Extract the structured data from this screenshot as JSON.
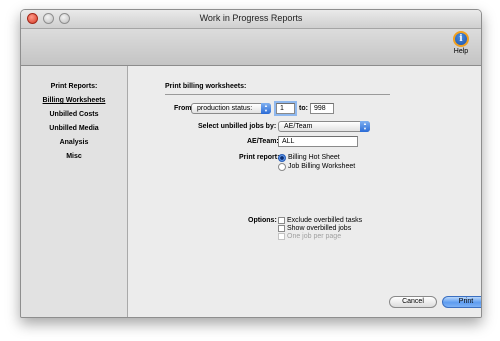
{
  "window": {
    "title": "Work in Progress Reports"
  },
  "toolbar": {
    "help_label": "Help"
  },
  "sidebar": {
    "heading": "Print Reports:",
    "items": [
      {
        "label": "Billing Worksheets",
        "active": true
      },
      {
        "label": "Unbilled Costs"
      },
      {
        "label": "Unbilled Media"
      },
      {
        "label": "Analysis"
      },
      {
        "label": "Misc"
      }
    ]
  },
  "main": {
    "section_title": "Print billing worksheets:",
    "from_label": "From",
    "from_popup": "production status:",
    "from_value": "1",
    "to_label": "to:",
    "to_value": "998",
    "select_label": "Select unbilled jobs by:",
    "select_popup": "AE/Team",
    "ae_label": "AE/Team:",
    "ae_value": "ALL",
    "print_report_label": "Print report:",
    "radio_options": [
      "Billing Hot Sheet",
      "Job Billing Worksheet"
    ],
    "options_label": "Options:",
    "checkboxes": [
      "Exclude overbilled tasks",
      "Show overbilled jobs",
      "One job per page"
    ],
    "cancel_label": "Cancel",
    "print_label": "Print"
  },
  "colors": {
    "accent": "#5e9cf0",
    "sidebar_bg": "#e2e2e2",
    "panel_bg": "#ececec"
  }
}
